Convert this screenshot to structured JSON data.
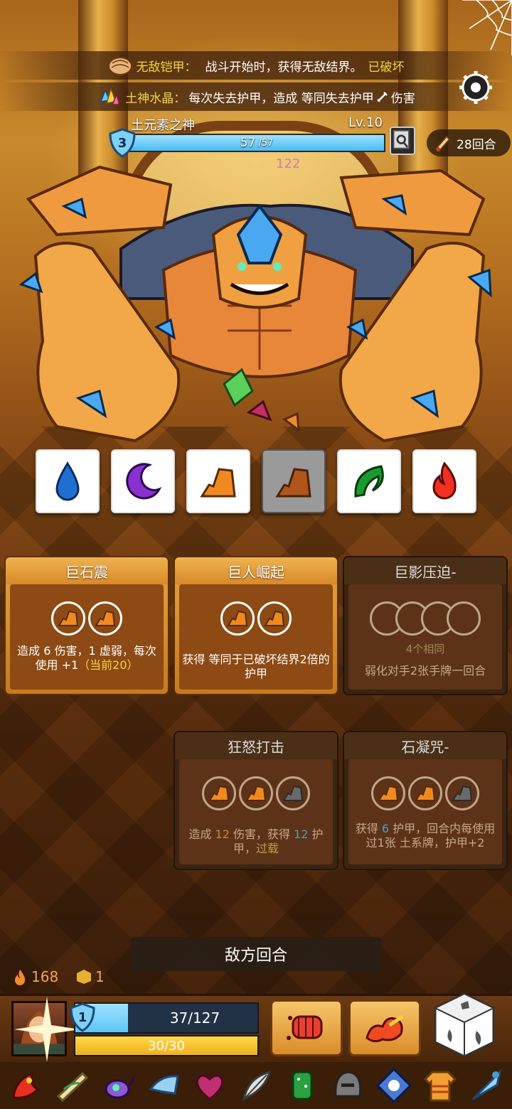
{
  "banners": [
    {
      "name": "无敌铠甲",
      "colon": "：",
      "text": "战斗开始时，获得无敌结界。",
      "status": "已破坏"
    },
    {
      "name": "土神水晶",
      "colon": "：",
      "text": "每次失去护甲，造成 等同失去护甲",
      "suffix": "伤害"
    }
  ],
  "enemy": {
    "name": "土元素之神",
    "level": "Lv.10",
    "shield": "3",
    "hp_current": "57",
    "hp_max": "/57",
    "hp_fraction": 1.0,
    "floating_text": "122"
  },
  "turn_counter": "28回合",
  "dice": [
    {
      "type": "water",
      "color": "#1f6fd0",
      "selected": false
    },
    {
      "type": "moon",
      "color": "#8a2fd0",
      "selected": false
    },
    {
      "type": "earth",
      "color": "#f08a20",
      "selected": false
    },
    {
      "type": "earth",
      "color": "#b0561a",
      "selected": true
    },
    {
      "type": "leaf",
      "color": "#1a9a30",
      "selected": false
    },
    {
      "type": "fire",
      "color": "#f03020",
      "selected": false
    }
  ],
  "cards": {
    "c1": {
      "title": "巨石震",
      "d1": "造成 ",
      "d2": "6",
      "d3": " 伤害，",
      "d4": "1",
      "d5": " 虚弱，每次使用 ",
      "d6": "+1",
      "d7": "（当前20）"
    },
    "c2": {
      "title": "巨人崛起",
      "d1": "获得 等同于已破坏结界2倍的",
      "d2": " 护甲"
    },
    "c3": {
      "title": "巨影压迫-",
      "req": "4个相同",
      "d1": "弱化对手2张手牌一回合"
    },
    "c4": {
      "title": "狂怒打击",
      "d1": "造成 ",
      "d2": "12",
      "d3": " 伤害，获得 ",
      "d4": "12",
      "d5": " 护甲，",
      "d6": "过载"
    },
    "c5": {
      "title": "石凝咒-",
      "d1": "获得 ",
      "d2": "6",
      "d3": " 护甲，回合内每使用过1张 ",
      "d4": "土系牌，",
      "d5": "护甲+2"
    }
  },
  "enemy_turn_button": "敌方回合",
  "resources": {
    "fire": "168",
    "gold": "1"
  },
  "player": {
    "shield": "1",
    "hp": "37/127",
    "hp_fraction": 0.29,
    "energy": "30/30",
    "energy_fraction": 1.0
  },
  "relics": [
    "dragon-horn",
    "wing-scroll",
    "teapot",
    "horn",
    "heart-charm",
    "feather",
    "cactus",
    "helmet",
    "snowflake-rune",
    "sweater",
    "ice-dagger"
  ]
}
